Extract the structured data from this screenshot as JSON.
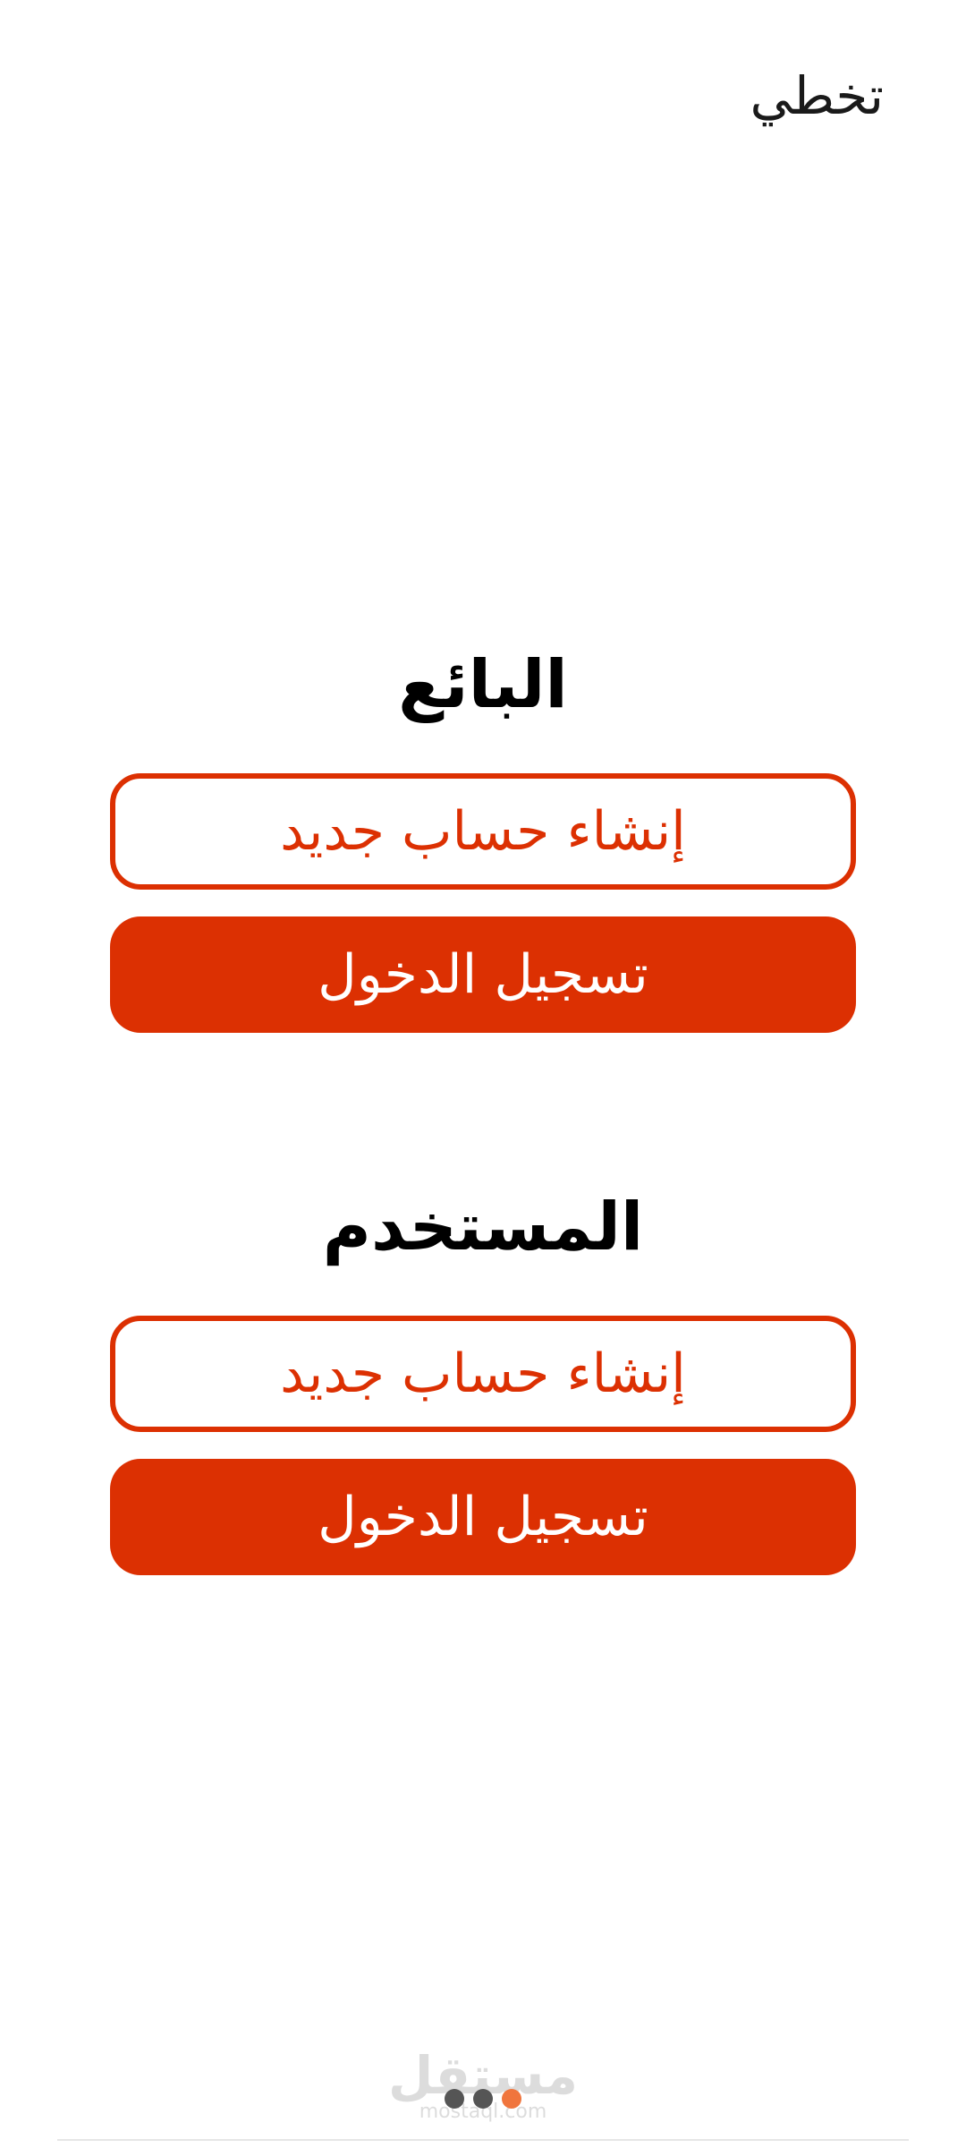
{
  "header": {
    "skip_label": "تخطي"
  },
  "seller": {
    "title": "البائع",
    "register_label": "إنشاء حساب جديد",
    "login_label": "تسجيل الدخول"
  },
  "user": {
    "title": "المستخدم",
    "register_label": "إنشاء حساب جديد",
    "login_label": "تسجيل الدخول"
  },
  "pager": {
    "count": 3,
    "active_index": 0,
    "colors": {
      "active": "#f0753d",
      "inactive": "#555555"
    }
  },
  "watermark": {
    "arabic": "مستقل",
    "latin": "mostaql.com"
  },
  "colors": {
    "accent": "#dc3002",
    "text": "#000000",
    "background": "#ffffff"
  }
}
